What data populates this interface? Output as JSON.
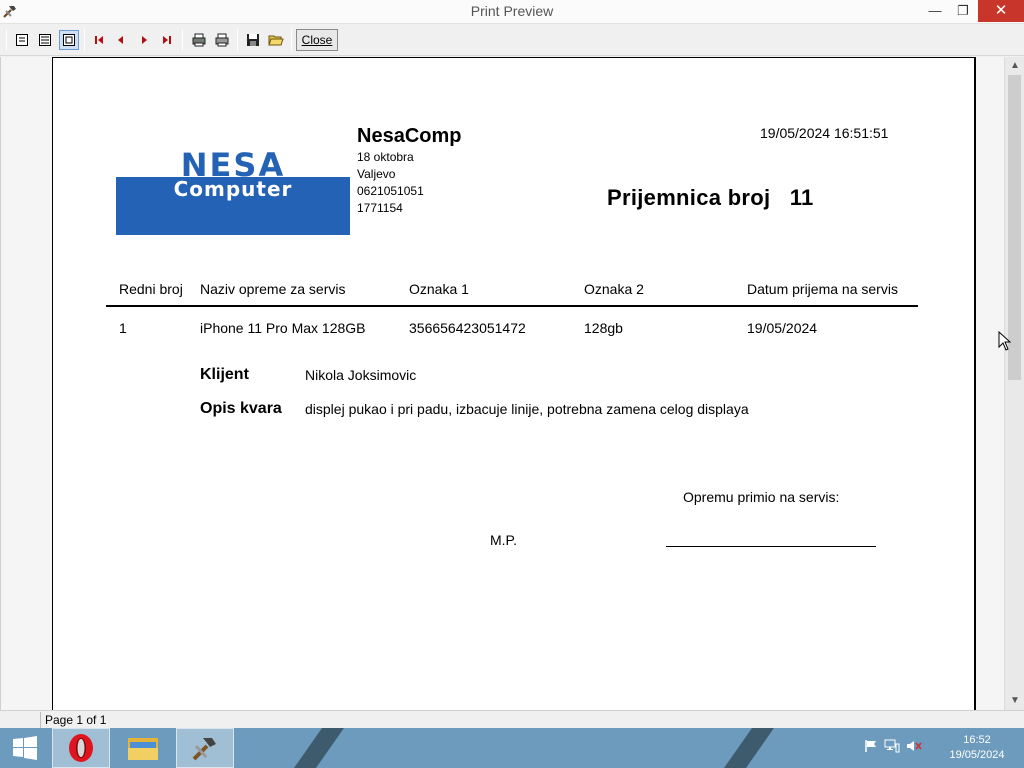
{
  "window": {
    "title": "Print Preview",
    "minimize_icon": "minimize-icon",
    "maximize_icon": "restore-icon",
    "close_icon": "close-icon"
  },
  "toolbar": {
    "buttons": [
      "one-page-icon",
      "two-page-icon",
      "zoom-icon",
      "first-page-icon",
      "prev-page-icon",
      "next-page-icon",
      "last-page-icon",
      "print-setup-icon",
      "print-icon",
      "save-icon",
      "open-icon"
    ],
    "close_label": "Close"
  },
  "status": {
    "page_text": "Page 1 of 1"
  },
  "document": {
    "company": {
      "logo_line1": "NESA",
      "logo_line2": "Computer",
      "name": "NesaComp",
      "address": "18 oktobra",
      "city": "Valjevo",
      "phone": "0621051051",
      "id": "1771154"
    },
    "timestamp": "19/05/2024 16:51:51",
    "receipt_title": "Prijemnica broj",
    "receipt_number": "11",
    "table": {
      "headers": [
        "Redni broj",
        "Naziv opreme za servis",
        "Oznaka 1",
        "Oznaka 2",
        "Datum prijema na servis"
      ],
      "rows": [
        [
          "1",
          "iPhone 11 Pro Max 128GB",
          "356656423051472",
          "128gb",
          "19/05/2024"
        ]
      ]
    },
    "client_label": "Klijent",
    "client_value": "Nikola Joksimovic",
    "fault_label": "Opis kvara",
    "fault_value": "displej pukao i pri padu, izbacuje linije, potrebna zamena celog displaya",
    "signature_caption": "Opremu primio na servis:",
    "stamp_label": "M.P."
  },
  "taskbar": {
    "start_icon": "windows-start-icon",
    "apps": [
      "opera-icon",
      "file-explorer-icon",
      "print-preview-app-icon"
    ],
    "tray_icons": [
      "action-center-flag-icon",
      "network-icon",
      "volume-muted-icon"
    ],
    "time": "16:52",
    "date": "19/05/2024"
  },
  "colors": {
    "logo_blue": "#2362b4",
    "taskbar": "#6d9bbd",
    "close_red": "#c7352b"
  }
}
